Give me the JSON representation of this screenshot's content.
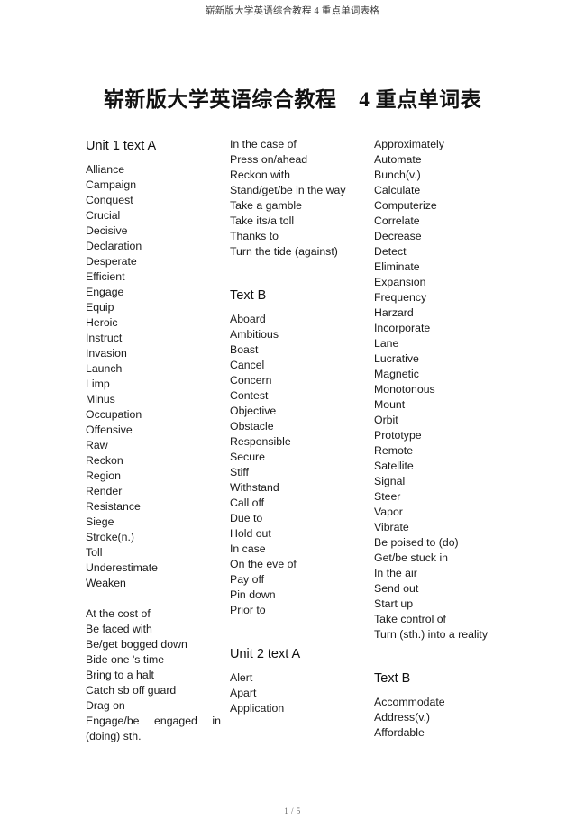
{
  "header": {
    "running_title": "崭新版大学英语综合教程 4 重点单词表格"
  },
  "title": "崭新版大学英语综合教程    4 重点单词表",
  "footer": {
    "page_number": "1 / 5"
  },
  "columns": [
    {
      "id": "column-1",
      "sections": [
        {
          "heading": "Unit 1 text A",
          "items": [
            "Alliance",
            "Campaign",
            "Conquest",
            "Crucial",
            "Decisive",
            "Declaration",
            "Desperate",
            "Efficient",
            "Engage",
            "Equip",
            "Heroic",
            "Instruct",
            "Invasion",
            "Launch",
            "Limp",
            "Minus",
            "Occupation",
            "Offensive",
            "Raw",
            "Reckon",
            "Region",
            "Render",
            "Resistance",
            "Siege",
            "Stroke(n.)",
            "Toll",
            "Underestimate",
            "Weaken"
          ]
        },
        {
          "heading": "",
          "items": [
            "At the cost of",
            "Be faced with",
            "Be/get bogged down",
            "Bide one 's time",
            "Bring to a halt",
            "Catch sb off guard",
            "Drag on",
            "Engage/be  engaged in (doing) sth."
          ]
        }
      ]
    },
    {
      "id": "column-2",
      "sections": [
        {
          "heading": "",
          "items": [
            "In the case of",
            "Press on/ahead",
            "Reckon with",
            "Stand/get/be in the way",
            "Take a gamble",
            "Take its/a toll",
            "Thanks to",
            "Turn the tide (against)"
          ]
        },
        {
          "heading": "Text B",
          "items": [
            "Aboard",
            "Ambitious",
            "Boast",
            "Cancel",
            "Concern",
            "Contest",
            "Objective",
            "Obstacle",
            "Responsible",
            "Secure",
            "Stiff",
            "Withstand",
            "Call off",
            "Due to",
            "Hold out",
            "In case",
            "On the eve of",
            "Pay off",
            "Pin down",
            "Prior to"
          ]
        },
        {
          "heading": "Unit 2 text A",
          "items": [
            "Alert",
            "Apart",
            "Application"
          ]
        }
      ]
    },
    {
      "id": "column-3",
      "sections": [
        {
          "heading": "",
          "items": [
            "Approximately",
            "Automate",
            "Bunch(v.)",
            "Calculate",
            "Computerize",
            "Correlate",
            "Decrease",
            "Detect",
            "Eliminate",
            "Expansion",
            "Frequency",
            "Harzard",
            "Incorporate",
            "Lane",
            "Lucrative",
            "Magnetic",
            "Monotonous",
            "Mount",
            "Orbit",
            "Prototype",
            "Remote",
            "Satellite",
            "Signal",
            "Steer",
            "Vapor",
            "Vibrate",
            "Be poised to (do)",
            "Get/be stuck in",
            "In the air",
            "Send out",
            "Start up",
            "Take control of",
            "Turn  (sth.) into a reality"
          ]
        },
        {
          "heading": "Text B",
          "items": [
            "Accommodate",
            "Address(v.)",
            "Affordable"
          ]
        }
      ]
    }
  ]
}
